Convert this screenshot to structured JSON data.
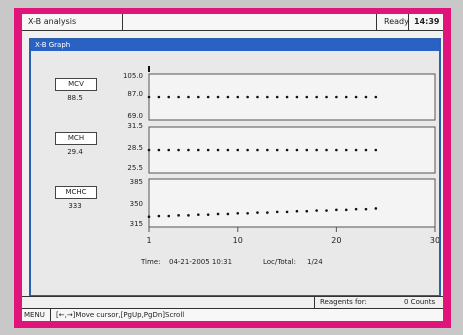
{
  "header": {
    "title": "X-B analysis",
    "status": "Ready",
    "time": "14:39"
  },
  "window": {
    "title": "X-B Graph"
  },
  "params": [
    {
      "name": "MCV",
      "value": "88.5",
      "ticks": [
        "105.0",
        "87.0",
        "69.0"
      ]
    },
    {
      "name": "MCH",
      "value": "29.4",
      "ticks": [
        "31.5",
        "28.5",
        "25.5"
      ]
    },
    {
      "name": "MCHC",
      "value": "333",
      "ticks": [
        "385",
        "350",
        "315"
      ]
    }
  ],
  "xticks": [
    "1",
    "10",
    "20",
    "30"
  ],
  "footer": {
    "time_label": "Time:",
    "time_value": "04-21-2005 10:31",
    "loc_label": "Loc/Total:",
    "loc_value": "1/24"
  },
  "status_bar": {
    "reagents_label": "Reagents for:",
    "reagents_value": "0 Counts"
  },
  "help_bar": {
    "menu": "MENU",
    "hint": "[←,→]Move cursor,[PgUp,PgDn]Scroll"
  },
  "colors": {
    "frame": "#e0147a",
    "window_border": "#2d5fb0",
    "title_bar": "#2a62c4"
  },
  "chart_data": [
    {
      "type": "scatter",
      "name": "MCV",
      "x": [
        1,
        2,
        3,
        4,
        5,
        6,
        7,
        8,
        9,
        10,
        11,
        12,
        13,
        14,
        15,
        16,
        17,
        18,
        19,
        20,
        21,
        22,
        23,
        24
      ],
      "values": [
        87,
        87,
        87,
        87,
        87,
        87,
        87,
        87,
        87,
        87,
        87,
        87,
        87,
        87,
        87,
        87,
        87,
        87,
        87,
        87,
        87,
        87,
        87,
        87
      ],
      "ylim": [
        69,
        105
      ]
    },
    {
      "type": "scatter",
      "name": "MCH",
      "x": [
        1,
        2,
        3,
        4,
        5,
        6,
        7,
        8,
        9,
        10,
        11,
        12,
        13,
        14,
        15,
        16,
        17,
        18,
        19,
        20,
        21,
        22,
        23,
        24
      ],
      "values": [
        28.5,
        28.5,
        28.5,
        28.5,
        28.5,
        28.5,
        28.5,
        28.5,
        28.5,
        28.5,
        28.5,
        28.5,
        28.5,
        28.5,
        28.5,
        28.5,
        28.5,
        28.5,
        28.5,
        28.5,
        28.5,
        28.5,
        28.5,
        28.5
      ],
      "ylim": [
        25.5,
        31.5
      ]
    },
    {
      "type": "scatter",
      "name": "MCHC",
      "x": [
        1,
        2,
        3,
        4,
        5,
        6,
        7,
        8,
        9,
        10,
        11,
        12,
        13,
        14,
        15,
        16,
        17,
        18,
        19,
        20,
        21,
        22,
        23,
        24
      ],
      "values": [
        330,
        331,
        331,
        332,
        332,
        333,
        333,
        334,
        334,
        335,
        335,
        336,
        336,
        337,
        337,
        338,
        338,
        339,
        339,
        340,
        340,
        341,
        341,
        342
      ],
      "ylim": [
        315,
        385
      ]
    }
  ]
}
